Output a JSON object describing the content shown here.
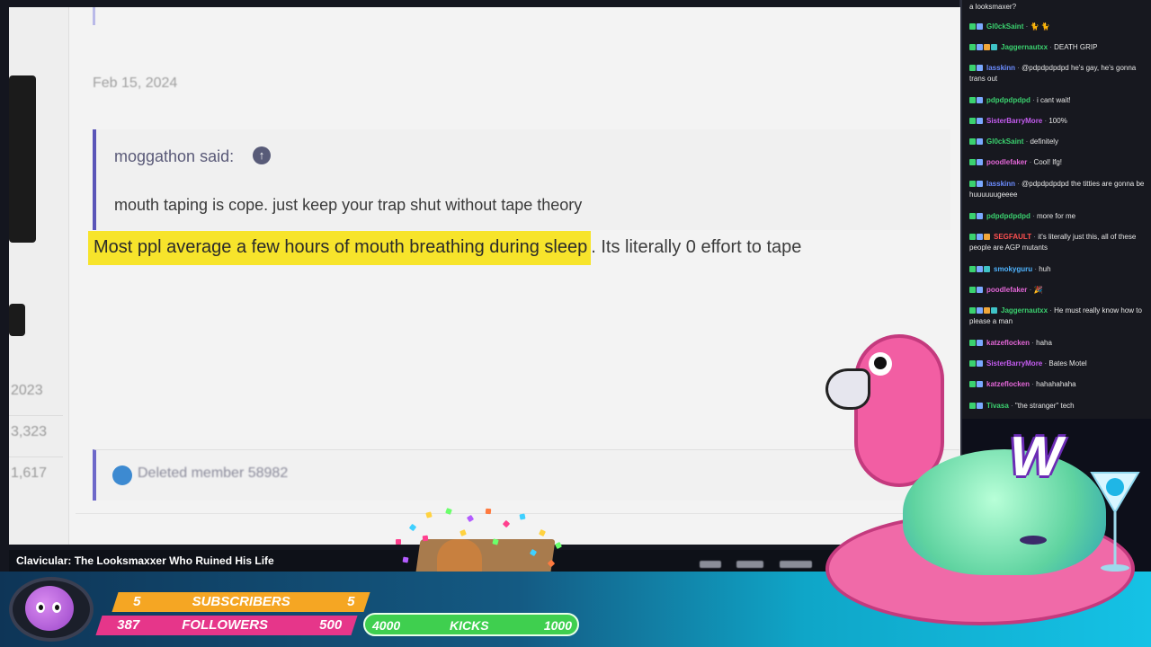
{
  "forum": {
    "post_date": "Feb 15, 2024",
    "left_stats": [
      "2023",
      "3,323",
      "1,617"
    ],
    "quote": {
      "author_label": "moggathon said:",
      "arrow_icon": "arrow-up-icon",
      "text": "mouth taping is cope. just keep your trap shut without tape theory"
    },
    "reply": {
      "highlighted": "Most ppl average a few hours of mouth breathing during sleep",
      "rest": ". Its literally 0 effort to tape"
    },
    "next_post_author": "Deleted member 58982"
  },
  "video": {
    "title": "Clavicular: The Looksmaxxer Who Ruined His Life"
  },
  "chat": {
    "top_fragment": "a looksmaxer?",
    "messages": [
      {
        "user": "Gl0ckSaint",
        "color": "#3bd16f",
        "text": "🐈 🐈",
        "badges": [
          "green",
          "blue"
        ]
      },
      {
        "user": "Jaggernautxx",
        "color": "#3bd16f",
        "text": "DEATH GRIP",
        "badges": [
          "green",
          "blue",
          "orange",
          "teal"
        ]
      },
      {
        "user": "lasskinn",
        "color": "#6b8cff",
        "text": "@pdpdpdpdpd he's gay, he's gonna trans out",
        "badges": [
          "green",
          "blue"
        ]
      },
      {
        "user": "pdpdpdpdpd",
        "color": "#3bd16f",
        "text": "i cant wait!",
        "badges": [
          "green",
          "blue"
        ]
      },
      {
        "user": "SisterBarryMore",
        "color": "#c45cf0",
        "text": "100%",
        "badges": [
          "green",
          "blue"
        ]
      },
      {
        "user": "Gl0ckSaint",
        "color": "#3bd16f",
        "text": "definitely",
        "badges": [
          "green",
          "blue"
        ]
      },
      {
        "user": "poodlefaker",
        "color": "#e266d6",
        "text": "Cool! lfg!",
        "badges": [
          "green",
          "blue"
        ]
      },
      {
        "user": "lasskinn",
        "color": "#6b8cff",
        "text": "@pdpdpdpdpd the titties are gonna be huuuuuugeeee",
        "badges": [
          "green",
          "blue"
        ]
      },
      {
        "user": "pdpdpdpdpd",
        "color": "#3bd16f",
        "text": "more for me",
        "badges": [
          "green",
          "blue"
        ]
      },
      {
        "user": "SEGFAULT",
        "color": "#ff5050",
        "text": "it's literally just this, all of these people are AGP mutants",
        "badges": [
          "green",
          "blue",
          "orange"
        ]
      },
      {
        "user": "smokyguru",
        "color": "#4fb4ff",
        "text": "huh",
        "badges": [
          "green",
          "blue",
          "teal"
        ]
      },
      {
        "user": "poodlefaker",
        "color": "#e266d6",
        "text": "🎉",
        "badges": [
          "green",
          "blue"
        ]
      },
      {
        "user": "Jaggernautxx",
        "color": "#3bd16f",
        "text": "He must really know how to please a man",
        "badges": [
          "green",
          "blue",
          "orange",
          "teal"
        ]
      },
      {
        "user": "katzeflocken",
        "color": "#e266d6",
        "text": "haha",
        "badges": [
          "green",
          "blue"
        ]
      },
      {
        "user": "SisterBarryMore",
        "color": "#c45cf0",
        "text": "Bates Motel",
        "badges": [
          "green",
          "blue"
        ]
      },
      {
        "user": "katzeflocken",
        "color": "#e266d6",
        "text": "hahahahaha",
        "badges": [
          "green",
          "blue"
        ]
      },
      {
        "user": "Tivasa",
        "color": "#3bd16f",
        "text": "\"the stranger\" tech",
        "badges": [
          "green",
          "blue"
        ]
      }
    ]
  },
  "goals": {
    "subscribers": {
      "current": "5",
      "label": "SUBSCRIBERS",
      "goal": "5"
    },
    "followers": {
      "current": "387",
      "label": "FOLLOWERS",
      "goal": "500"
    },
    "kicks": {
      "current": "4000",
      "label": "KICKS",
      "goal": "1000"
    }
  },
  "overlay": {
    "logo_letter": "W"
  }
}
